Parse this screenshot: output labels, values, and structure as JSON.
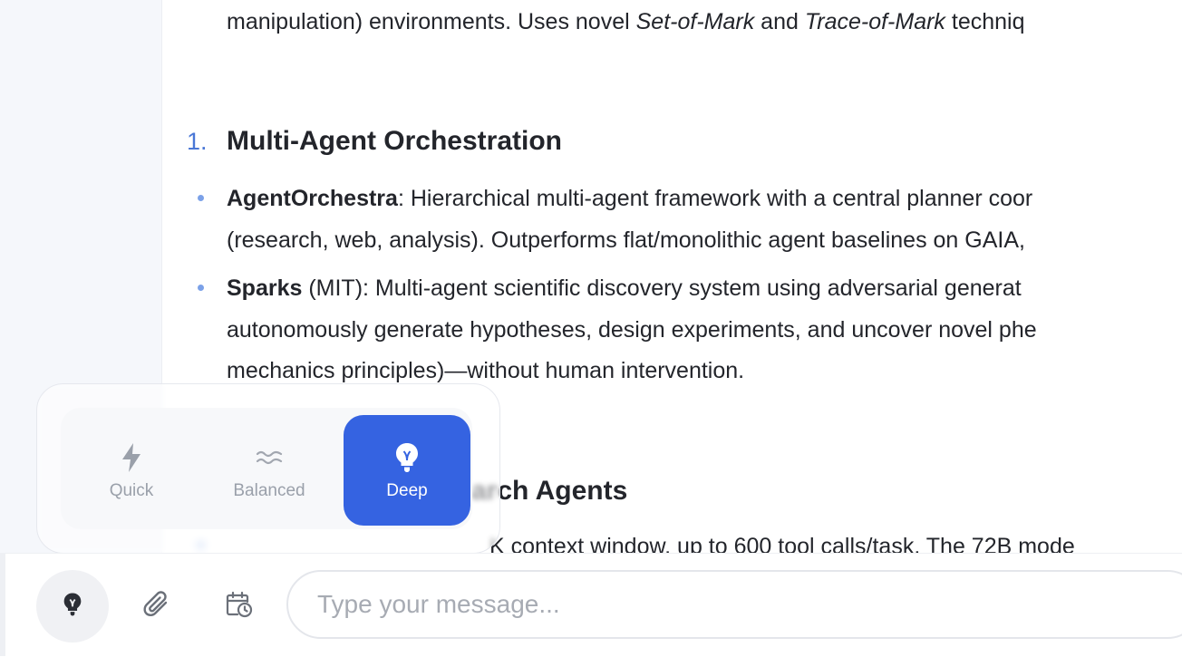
{
  "content": {
    "top_line": {
      "before": "manipulation) environments. Uses novel ",
      "em1": "Set-of-Mark",
      "mid": " and ",
      "em2": "Trace-of-Mark",
      "after": " techniq"
    },
    "section1": {
      "number": "1.",
      "title": "Multi-Agent Orchestration",
      "items": [
        {
          "bold": "AgentOrchestra",
          "line1": ": Hierarchical multi-agent framework with a central planner coor",
          "line2": "(research, web, analysis). Outperforms flat/monolithic agent baselines on GAIA, "
        },
        {
          "bold": "Sparks",
          "line1": " (MIT): Multi-agent scientific discovery system using adversarial generat",
          "line2": "autonomously generate hypotheses, design experiments, and uncover novel phe",
          "line3": "mechanics principles)—without human intervention."
        }
      ]
    },
    "section2": {
      "title_visible": "arch Agents",
      "item_line": "K context window, up to 600 tool calls/task. The 72B mode"
    }
  },
  "mode_selector": {
    "options": [
      {
        "label": "Quick",
        "icon": "lightning-icon"
      },
      {
        "label": "Balanced",
        "icon": "waves-icon"
      },
      {
        "label": "Deep",
        "icon": "lightbulb-icon"
      }
    ],
    "selected": "Deep",
    "accent_color": "#3563e1"
  },
  "input_bar": {
    "placeholder": "Type your message...",
    "buttons": [
      "lightbulb-icon",
      "paperclip-icon",
      "calendar-clock-icon"
    ]
  }
}
